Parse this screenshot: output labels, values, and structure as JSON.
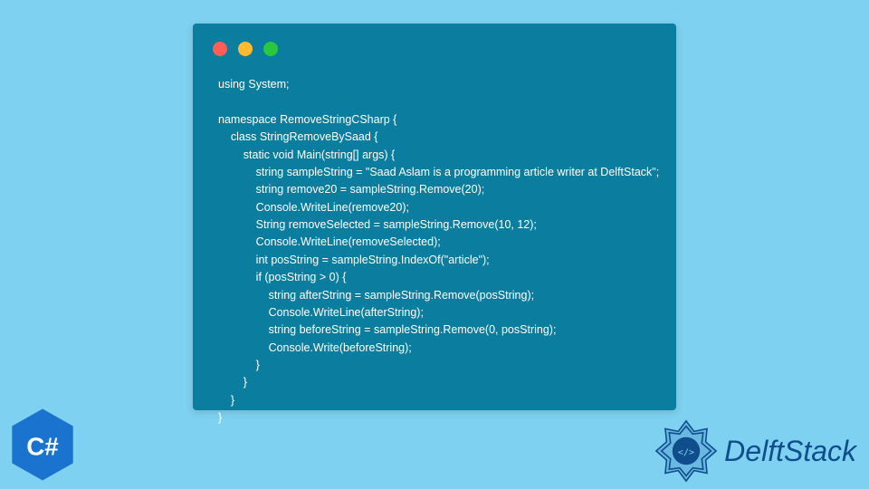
{
  "code": {
    "line1": "using System;",
    "line2": "",
    "line3": "namespace RemoveStringCSharp {",
    "line4": "    class StringRemoveBySaad {",
    "line5": "        static void Main(string[] args) {",
    "line6": "            string sampleString = \"Saad Aslam is a programming article writer at DelftStack\";",
    "line7": "            string remove20 = sampleString.Remove(20);",
    "line8": "            Console.WriteLine(remove20);",
    "line9": "            String removeSelected = sampleString.Remove(10, 12);",
    "line10": "            Console.WriteLine(removeSelected);",
    "line11": "            int posString = sampleString.IndexOf(\"article\");",
    "line12": "            if (posString > 0) {",
    "line13": "                string afterString = sampleString.Remove(posString);",
    "line14": "                Console.WriteLine(afterString);",
    "line15": "                string beforeString = sampleString.Remove(0, posString);",
    "line16": "                Console.Write(beforeString);",
    "line17": "            }",
    "line18": "        }",
    "line19": "    }",
    "line20": "}"
  },
  "badge": {
    "label": "C#"
  },
  "brand": {
    "name": "DelftStack"
  },
  "colors": {
    "bg": "#7ed1f0",
    "window": "#0b7d9f",
    "badge": "#1b73d0",
    "brand": "#0f4d8c"
  }
}
